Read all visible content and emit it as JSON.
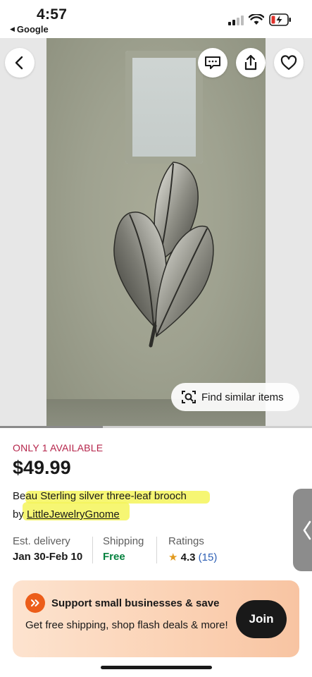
{
  "status_bar": {
    "time": "4:57",
    "back_app": "Google",
    "back_arrow": "◀"
  },
  "product_image": {
    "find_similar_label": "Find similar items",
    "carousel_progress": 0.33
  },
  "listing": {
    "availability": "ONLY 1 AVAILABLE",
    "price": "$49.99",
    "title": "Beau Sterling silver three-leaf brooch",
    "seller_prefix": "by",
    "seller_name": "LittleJewelryGnome"
  },
  "stats": {
    "delivery_label": "Est. delivery",
    "delivery_value": "Jan 30-Feb 10",
    "shipping_label": "Shipping",
    "shipping_value": "Free",
    "ratings_label": "Ratings",
    "rating_star": "★",
    "rating_value": "4.3",
    "rating_count": "(15)"
  },
  "promo": {
    "title": "Support small businesses & save",
    "text": "Get free shipping, shop flash deals & more!",
    "join_label": "Join"
  },
  "colors": {
    "availability": "#b5244a",
    "free_shipping": "#05823f",
    "star": "#e29a1e",
    "rating_count": "#2d5fb5",
    "promo_icon": "#ec5d1a",
    "highlight": "#f4f55a"
  },
  "icons": {
    "back": "chevron-left-icon",
    "message": "message-icon",
    "share": "share-icon",
    "favorite": "heart-icon",
    "find_similar": "camera-search-icon",
    "promo": "double-chevron-right-icon",
    "side_tab": "chevron-left-icon"
  }
}
